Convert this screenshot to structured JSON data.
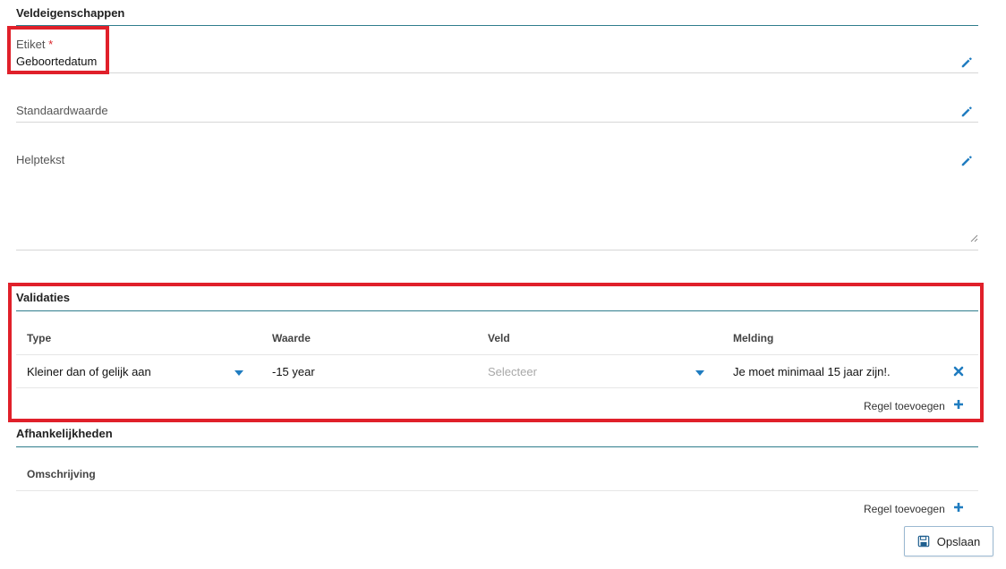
{
  "colors": {
    "accent": "#1f7cc0",
    "teal": "#2f7d8c",
    "required": "#d9262c",
    "highlight": "#e0202a"
  },
  "properties": {
    "title": "Veldeigenschappen",
    "label_field": {
      "label": "Etiket",
      "required_mark": "*",
      "value": "Geboortedatum"
    },
    "default_field": {
      "label": "Standaardwaarde"
    },
    "help_field": {
      "label": "Helptekst"
    }
  },
  "validations": {
    "title": "Validaties",
    "columns": [
      "Type",
      "Waarde",
      "Veld",
      "Melding"
    ],
    "rows": [
      {
        "type": "Kleiner dan of gelijk aan",
        "value": "-15 year",
        "field_placeholder": "Selecteer",
        "message": "Je moet minimaal 15 jaar zijn!."
      }
    ],
    "add_label": "Regel toevoegen"
  },
  "dependencies": {
    "title": "Afhankelijkheden",
    "columns": [
      "Omschrijving"
    ],
    "add_label": "Regel toevoegen"
  },
  "save_label": "Opslaan"
}
